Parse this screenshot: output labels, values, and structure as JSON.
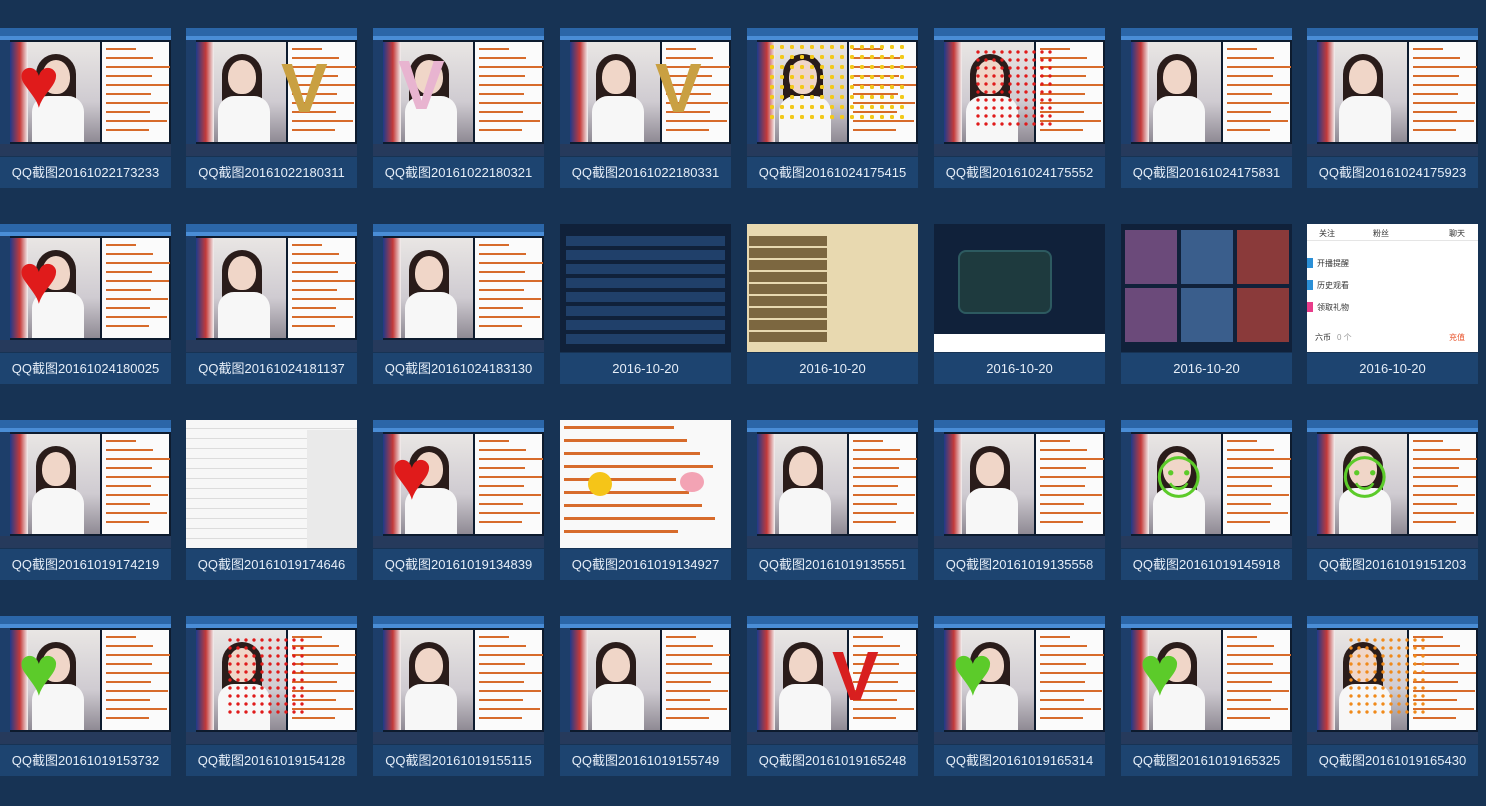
{
  "tiles": [
    {
      "caption": "QQ截图20161022173233",
      "icon": "screenshot-thumbnail",
      "overlay": "red-heart"
    },
    {
      "caption": "QQ截图20161022180311",
      "icon": "screenshot-thumbnail",
      "overlay": "gold-v"
    },
    {
      "caption": "QQ截图20161022180321",
      "icon": "screenshot-thumbnail",
      "overlay": "pink-v"
    },
    {
      "caption": "QQ截图20161022180331",
      "icon": "screenshot-thumbnail",
      "overlay": "gold-v"
    },
    {
      "caption": "QQ截图20161024175415",
      "icon": "screenshot-thumbnail",
      "overlay": "yellow-dots"
    },
    {
      "caption": "QQ截图20161024175552",
      "icon": "screenshot-thumbnail",
      "overlay": "red-dots"
    },
    {
      "caption": "QQ截图20161024175831",
      "icon": "screenshot-thumbnail",
      "overlay": "none"
    },
    {
      "caption": "QQ截图20161024175923",
      "icon": "screenshot-thumbnail",
      "overlay": "none"
    },
    {
      "caption": "QQ截图20161024180025",
      "icon": "screenshot-thumbnail",
      "overlay": "red-heart"
    },
    {
      "caption": "QQ截图20161024181137",
      "icon": "screenshot-thumbnail",
      "overlay": "none"
    },
    {
      "caption": "QQ截图20161024183130",
      "icon": "screenshot-thumbnail",
      "overlay": "none"
    },
    {
      "caption": "2016-10-20",
      "icon": "game-stats-thumbnail",
      "overlay": "game-dark"
    },
    {
      "caption": "2016-10-20",
      "icon": "game-panel-thumbnail",
      "overlay": "game-panel"
    },
    {
      "caption": "2016-10-20",
      "icon": "game-dark-thumbnail",
      "overlay": "game-dark"
    },
    {
      "caption": "2016-10-20",
      "icon": "game-cards-thumbnail",
      "overlay": "game-dark"
    },
    {
      "caption": "2016-10-20",
      "icon": "mobile-menu-thumbnail",
      "overlay": "mobile"
    },
    {
      "caption": "QQ截图20161019174219",
      "icon": "screenshot-thumbnail",
      "overlay": "none"
    },
    {
      "caption": "QQ截图20161019174646",
      "icon": "table-thumbnail",
      "overlay": "table"
    },
    {
      "caption": "QQ截图20161019134839",
      "icon": "screenshot-thumbnail",
      "overlay": "red-heart"
    },
    {
      "caption": "QQ截图20161019134927",
      "icon": "chat-thumbnail",
      "overlay": "chat"
    },
    {
      "caption": "QQ截图20161019135551",
      "icon": "screenshot-thumbnail",
      "overlay": "none"
    },
    {
      "caption": "QQ截图20161019135558",
      "icon": "screenshot-thumbnail",
      "overlay": "none"
    },
    {
      "caption": "QQ截图20161019145918",
      "icon": "screenshot-thumbnail",
      "overlay": "green-smile"
    },
    {
      "caption": "QQ截图20161019151203",
      "icon": "screenshot-thumbnail",
      "overlay": "green-smile"
    },
    {
      "caption": "QQ截图20161019153732",
      "icon": "screenshot-thumbnail",
      "overlay": "green-heart"
    },
    {
      "caption": "QQ截图20161019154128",
      "icon": "screenshot-thumbnail",
      "overlay": "red-dots"
    },
    {
      "caption": "QQ截图20161019155115",
      "icon": "screenshot-thumbnail",
      "overlay": "none"
    },
    {
      "caption": "QQ截图20161019155749",
      "icon": "screenshot-thumbnail",
      "overlay": "none"
    },
    {
      "caption": "QQ截图20161019165248",
      "icon": "screenshot-thumbnail",
      "overlay": "red-v"
    },
    {
      "caption": "QQ截图20161019165314",
      "icon": "screenshot-thumbnail",
      "overlay": "green-heart"
    },
    {
      "caption": "QQ截图20161019165325",
      "icon": "screenshot-thumbnail",
      "overlay": "green-heart"
    },
    {
      "caption": "QQ截图20161019165430",
      "icon": "screenshot-thumbnail",
      "overlay": "orange-dots"
    }
  ],
  "mobile_menu": {
    "tabs": [
      "关注",
      "粉丝",
      "聊天"
    ],
    "items": [
      "开播提醒",
      "历史观看",
      "领取礼物"
    ],
    "coin_label": "六币",
    "coin_value": "0 个",
    "recharge": "充值"
  },
  "colors": {
    "background": "#173354",
    "caption_bg": "#1d4470",
    "caption_text": "#e6eef8"
  }
}
